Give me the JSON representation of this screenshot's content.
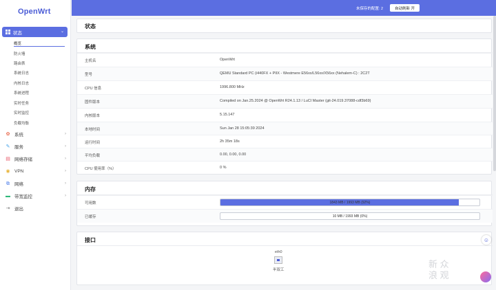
{
  "app": {
    "logo": "OpenWrt"
  },
  "header": {
    "unsaved": "未保存的配置: 2",
    "refresh_button": "自动刷新 开"
  },
  "sidebar": {
    "active": {
      "label": "状态",
      "icon": "grid-icon"
    },
    "sub_items": [
      "概览",
      "防火墙",
      "路由表",
      "系统日志",
      "内核日志",
      "系统进程",
      "实时任务",
      "实时监控",
      "负载均衡"
    ],
    "items": [
      {
        "label": "系统",
        "icon": "gear-icon"
      },
      {
        "label": "服务",
        "icon": "puzzle-icon"
      },
      {
        "label": "网络存储",
        "icon": "storage-icon"
      },
      {
        "label": "VPN",
        "icon": "vpn-icon"
      },
      {
        "label": "网络",
        "icon": "network-icon"
      },
      {
        "label": "带宽监控",
        "icon": "monitor-icon"
      },
      {
        "label": "退出",
        "icon": "logout-icon"
      }
    ]
  },
  "page": {
    "title": "状态"
  },
  "system": {
    "title": "系统",
    "rows": [
      {
        "k": "主机名",
        "v": "OpenWrt"
      },
      {
        "k": "型号",
        "v": "QEMU Standard PC (i440FX + PIIX - Westmere E56xx/L56xx/X56xx (Nehalem-C) : 2C2T"
      },
      {
        "k": "CPU 信息",
        "v": "1996.800 MHz"
      },
      {
        "k": "固件版本",
        "v": "Compiled on Jan.25.2024 @ OpenWrt R24.1.13 / LuCI Master (git-24.019.37088-cdf3b69)"
      },
      {
        "k": "内核版本",
        "v": "5.15.147"
      },
      {
        "k": "本地时间",
        "v": "Sun Jan 28 15:05:39 2024"
      },
      {
        "k": "运行时间",
        "v": "2h 35m 18s"
      },
      {
        "k": "平均负载",
        "v": "0.00, 0.00, 0.00"
      },
      {
        "k": "CPU 使用率（%）",
        "v": "0 %"
      }
    ]
  },
  "memory": {
    "title": "内存",
    "rows": [
      {
        "k": "可用数",
        "v": "1843 MB / 1993 MB (92%)",
        "fraction": 0.92
      },
      {
        "k": "已缓存",
        "v": "10 MB / 1993 MB (0%)",
        "fraction": 0.0
      }
    ]
  },
  "interfaces": {
    "title": "接口",
    "items": [
      {
        "name": "eth0",
        "status": "半双工",
        "icon": "ethernet-port-icon"
      }
    ]
  },
  "watermark": {
    "line1": "新 众",
    "line2": "浪 观"
  },
  "colors": {
    "accent": "#5b6ee1",
    "logo": "#4a5bd6"
  }
}
